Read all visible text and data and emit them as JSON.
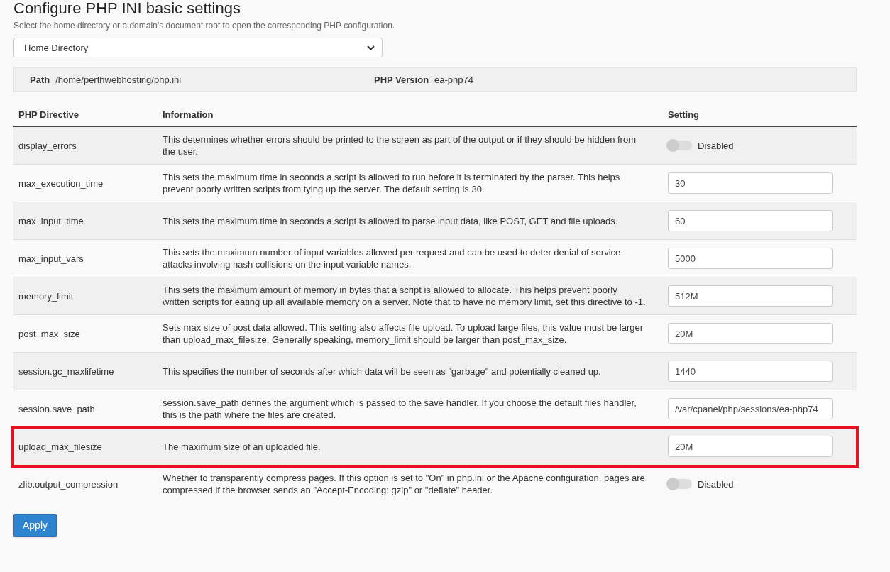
{
  "title": "Configure PHP INI basic settings",
  "subtitle": "Select the home directory or a domain’s document root to open the corresponding PHP configuration.",
  "location_select": {
    "value": "Home Directory"
  },
  "info_bar": [
    {
      "label": "Path",
      "value": "/home/perthwebhosting/php.ini"
    },
    {
      "label": "PHP Version",
      "value": "ea-php74"
    }
  ],
  "table": {
    "columns": [
      "PHP Directive",
      "Information",
      "Setting"
    ],
    "rows": [
      {
        "directive": "display_errors",
        "information": "This determines whether errors should be printed to the screen as part of the output or if they should be hidden from the user.",
        "setting": {
          "kind": "toggle",
          "on": false,
          "label": "Disabled"
        },
        "highlighted": false
      },
      {
        "directive": "max_execution_time",
        "information": "This sets the maximum time in seconds a script is allowed to run before it is terminated by the parser. This helps prevent poorly written scripts from tying up the server. The default setting is 30.",
        "setting": {
          "kind": "text",
          "value": "30"
        },
        "highlighted": false
      },
      {
        "directive": "max_input_time",
        "information": "This sets the maximum time in seconds a script is allowed to parse input data, like POST, GET and file uploads.",
        "setting": {
          "kind": "text",
          "value": "60"
        },
        "highlighted": false
      },
      {
        "directive": "max_input_vars",
        "information": "This sets the maximum number of input variables allowed per request and can be used to deter denial of service attacks involving hash collisions on the input variable names.",
        "setting": {
          "kind": "text",
          "value": "5000"
        },
        "highlighted": false
      },
      {
        "directive": "memory_limit",
        "information": "This sets the maximum amount of memory in bytes that a script is allowed to allocate. This helps prevent poorly written scripts for eating up all available memory on a server. Note that to have no memory limit, set this directive to -1.",
        "setting": {
          "kind": "text",
          "value": "512M"
        },
        "highlighted": false
      },
      {
        "directive": "post_max_size",
        "information": "Sets max size of post data allowed. This setting also affects file upload. To upload large files, this value must be larger than upload_max_filesize. Generally speaking, memory_limit should be larger than post_max_size.",
        "setting": {
          "kind": "text",
          "value": "20M"
        },
        "highlighted": false
      },
      {
        "directive": "session.gc_maxlifetime",
        "information": "This specifies the number of seconds after which data will be seen as \"garbage\" and potentially cleaned up.",
        "setting": {
          "kind": "text",
          "value": "1440"
        },
        "highlighted": false
      },
      {
        "directive": "session.save_path",
        "information": "session.save_path defines the argument which is passed to the save handler. If you choose the default files handler, this is the path where the files are created.",
        "setting": {
          "kind": "text",
          "value": "/var/cpanel/php/sessions/ea-php74"
        },
        "highlighted": false
      },
      {
        "directive": "upload_max_filesize",
        "information": "The maximum size of an uploaded file.",
        "setting": {
          "kind": "text",
          "value": "20M"
        },
        "highlighted": true
      },
      {
        "directive": "zlib.output_compression",
        "information": "Whether to transparently compress pages. If this option is set to \"On\" in php.ini or the Apache configuration, pages are compressed if the browser sends an \"Accept-Encoding: gzip\" or \"deflate\" header.",
        "setting": {
          "kind": "toggle",
          "on": false,
          "label": "Disabled"
        },
        "highlighted": false
      }
    ]
  },
  "apply_button": "Apply"
}
